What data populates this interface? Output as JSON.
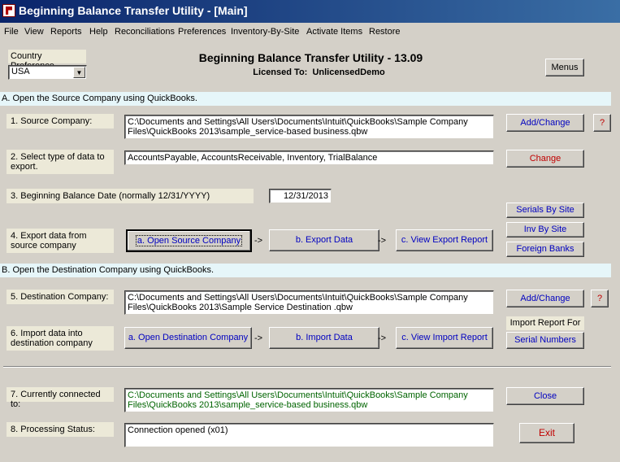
{
  "window": {
    "title": "Beginning Balance Transfer Utility - [Main]"
  },
  "menu": [
    "File",
    "View",
    "Reports",
    "Help",
    "Reconciliations",
    "Preferences",
    "Inventory-By-Site",
    "Activate Items",
    "Restore"
  ],
  "header": {
    "title": "Beginning Balance Transfer Utility - 13.09",
    "licensed_label": "Licensed To:",
    "licensed_value": "UnlicensedDemo",
    "menus_button": "Menus"
  },
  "country": {
    "label": "Country Preference",
    "value": "USA"
  },
  "sectionA": {
    "title": "A. Open the Source Company using QuickBooks.",
    "source_label": "1. Source Company:",
    "source_value": "C:\\Documents and Settings\\All Users\\Documents\\Intuit\\QuickBooks\\Sample Company Files\\QuickBooks 2013\\sample_service-based business.qbw",
    "add_change": "Add/Change",
    "help": "?",
    "type_label": "2. Select type of data to export.",
    "type_value": "AccountsPayable, AccountsReceivable, Inventory, TrialBalance",
    "change": "Change",
    "date_label": "3. Beginning Balance Date (normally 12/31/YYYY)",
    "date_value": "12/31/2013",
    "export_label": "4. Export data from source company",
    "open_source": "a. Open Source Company",
    "export_data": "b. Export Data",
    "view_export": "c. View Export Report",
    "arrow": "->",
    "serials_by_site": "Serials By Site",
    "inv_by_site": "Inv By Site",
    "foreign_banks": "Foreign Banks"
  },
  "sectionB": {
    "title": "B. Open the Destination Company using QuickBooks.",
    "dest_label": "5. Destination Company:",
    "dest_value": "C:\\Documents and Settings\\All Users\\Documents\\Intuit\\QuickBooks\\Sample Company Files\\QuickBooks 2013\\Sample Service Destination .qbw",
    "add_change": "Add/Change",
    "help": "?",
    "import_label": "6. Import  data into destination  company",
    "open_dest": "a. Open Destination  Company",
    "import_data": "b. Import Data",
    "view_import": "c. View Import Report",
    "arrow": "->",
    "import_report_for": "Import Report For",
    "serial_numbers": "Serial Numbers"
  },
  "status": {
    "connected_label": "7. Currently connected to:",
    "connected_value": "C:\\Documents and Settings\\All Users\\Documents\\Intuit\\QuickBooks\\Sample Company Files\\QuickBooks 2013\\sample_service-based business.qbw",
    "close": "Close",
    "processing_label": "8. Processing Status:",
    "processing_value": "Connection opened (x01)",
    "exit": "Exit"
  },
  "colors": {
    "title_bar": "#0a246a",
    "section_band": "#e6f6f9",
    "link_text": "#0000c0",
    "exit_text": "#c00000",
    "connected_text": "#006400"
  }
}
